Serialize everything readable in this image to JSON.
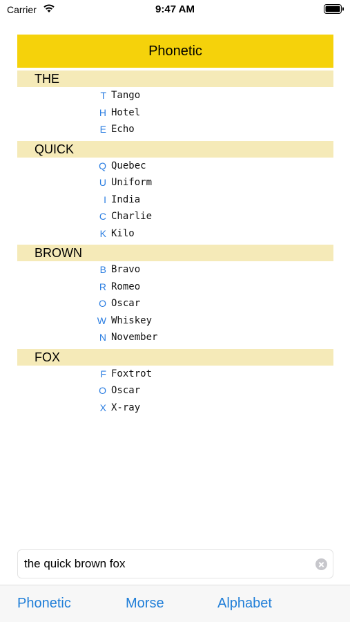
{
  "status": {
    "carrier": "Carrier",
    "time": "9:47 AM"
  },
  "header": {
    "title": "Phonetic"
  },
  "words": [
    {
      "word": "THE",
      "letters": [
        {
          "letter": "T",
          "code": "Tango"
        },
        {
          "letter": "H",
          "code": "Hotel"
        },
        {
          "letter": "E",
          "code": "Echo"
        }
      ]
    },
    {
      "word": "QUICK",
      "letters": [
        {
          "letter": "Q",
          "code": "Quebec"
        },
        {
          "letter": "U",
          "code": "Uniform"
        },
        {
          "letter": "I",
          "code": "India"
        },
        {
          "letter": "C",
          "code": "Charlie"
        },
        {
          "letter": "K",
          "code": "Kilo"
        }
      ]
    },
    {
      "word": "BROWN",
      "letters": [
        {
          "letter": "B",
          "code": "Bravo"
        },
        {
          "letter": "R",
          "code": "Romeo"
        },
        {
          "letter": "O",
          "code": "Oscar"
        },
        {
          "letter": "W",
          "code": "Whiskey"
        },
        {
          "letter": "N",
          "code": "November"
        }
      ]
    },
    {
      "word": "FOX",
      "letters": [
        {
          "letter": "F",
          "code": "Foxtrot"
        },
        {
          "letter": "O",
          "code": "Oscar"
        },
        {
          "letter": "X",
          "code": "X-ray"
        }
      ]
    }
  ],
  "search": {
    "value": "the quick brown fox"
  },
  "tabs": [
    {
      "label": "Phonetic"
    },
    {
      "label": "Morse"
    },
    {
      "label": "Alphabet"
    }
  ],
  "colors": {
    "header": "#f5d20b",
    "word_row": "#f5eab8",
    "accent": "#2a7de1"
  }
}
